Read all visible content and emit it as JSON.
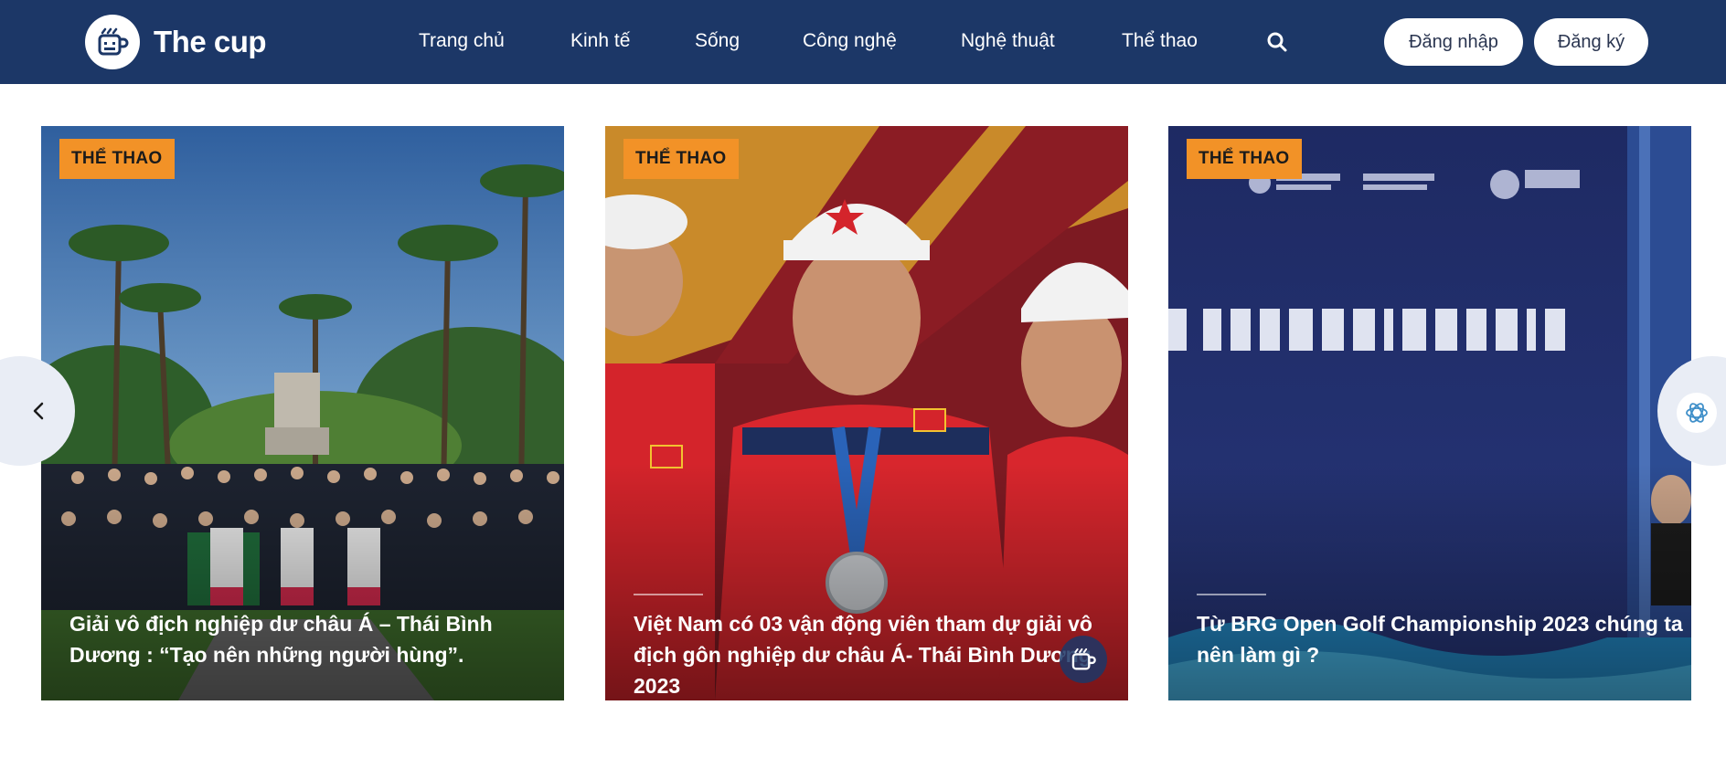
{
  "header": {
    "brand": "The cup",
    "logo_icon": "cup-icon",
    "nav": [
      {
        "label": "Trang chủ"
      },
      {
        "label": "Kinh tế"
      },
      {
        "label": "Sống"
      },
      {
        "label": "Công nghệ"
      },
      {
        "label": "Nghệ thuật"
      },
      {
        "label": "Thể thao"
      }
    ],
    "search_icon": "search-icon",
    "login_label": "Đăng nhập",
    "register_label": "Đăng ký"
  },
  "carousel": {
    "prev_icon": "chevron-left-icon",
    "next_icon": "openai-icon",
    "cards": [
      {
        "tag": "THỂ THAO",
        "title": "Giải vô địch nghiệp dư châu Á – Thái Bình Dương : “Tạo nên những người hùng”.",
        "image": "group-photo-golfers-park"
      },
      {
        "tag": "THỂ THAO",
        "title": "Việt Nam có 03 vận động viên tham dự giải vô địch gôn nghiệp dư châu Á- Thái Bình Dương 2023",
        "image": "vietnam-golfers-with-medal"
      },
      {
        "tag": "THỂ THAO",
        "title": "Từ BRG Open Golf Championship 2023 chúng ta nên làm gì ?",
        "image": "championship-banner-night"
      }
    ]
  },
  "colors": {
    "header_bg": "#1c3767",
    "tag_bg": "#f29227",
    "arrow_bg": "#e9edf5"
  }
}
